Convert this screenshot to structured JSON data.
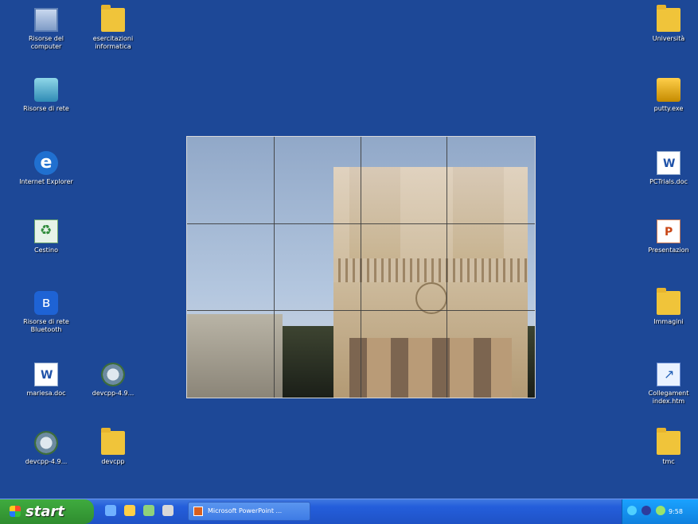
{
  "desktop_icons": [
    {
      "name": "computer-icon",
      "label": "Risorse del\ncomputer",
      "glyph": "computer"
    },
    {
      "name": "folder-icon",
      "label": "esercitazioni\ninformatica",
      "glyph": "folder"
    },
    {
      "name": "network-icon",
      "label": "Risorse di rete",
      "glyph": "network"
    },
    {
      "name": "internet-explorer-icon",
      "label": "Internet\nExplorer",
      "glyph": "ie"
    },
    {
      "name": "recycle-bin-icon",
      "label": "Cestino",
      "glyph": "recycle"
    },
    {
      "name": "bluetooth-icon",
      "label": "Risorse di rete\nBluetooth",
      "glyph": "bluetooth"
    },
    {
      "name": "document-icon",
      "label": "mariesa.doc",
      "glyph": "doc"
    },
    {
      "name": "setup-icon",
      "label": "devcpp-4.9...",
      "glyph": "setup"
    },
    {
      "name": "setup-icon-2",
      "label": "devcpp-4.9...",
      "glyph": "setup"
    },
    {
      "name": "folder-icon-2",
      "label": "devcpp",
      "glyph": "folder"
    },
    {
      "name": "folder-icon-right-1",
      "label": "Università",
      "glyph": "folder"
    },
    {
      "name": "putty-icon",
      "label": "putty.exe",
      "glyph": "putty"
    },
    {
      "name": "document-icon-right",
      "label": "PCTrials.doc",
      "glyph": "doc"
    },
    {
      "name": "presentation-icon",
      "label": "Presentazion",
      "glyph": "ppt"
    },
    {
      "name": "folder-icon-right-2",
      "label": "Immagini",
      "glyph": "folder"
    },
    {
      "name": "shortcut-icon",
      "label": "Collegament\nindex.htm",
      "glyph": "link"
    },
    {
      "name": "folder-icon-right-3",
      "label": "tmc",
      "glyph": "folder"
    }
  ],
  "taskbar": {
    "start_label": "start",
    "task_label": "Microsoft PowerPoint ...",
    "clock": "9:58"
  }
}
